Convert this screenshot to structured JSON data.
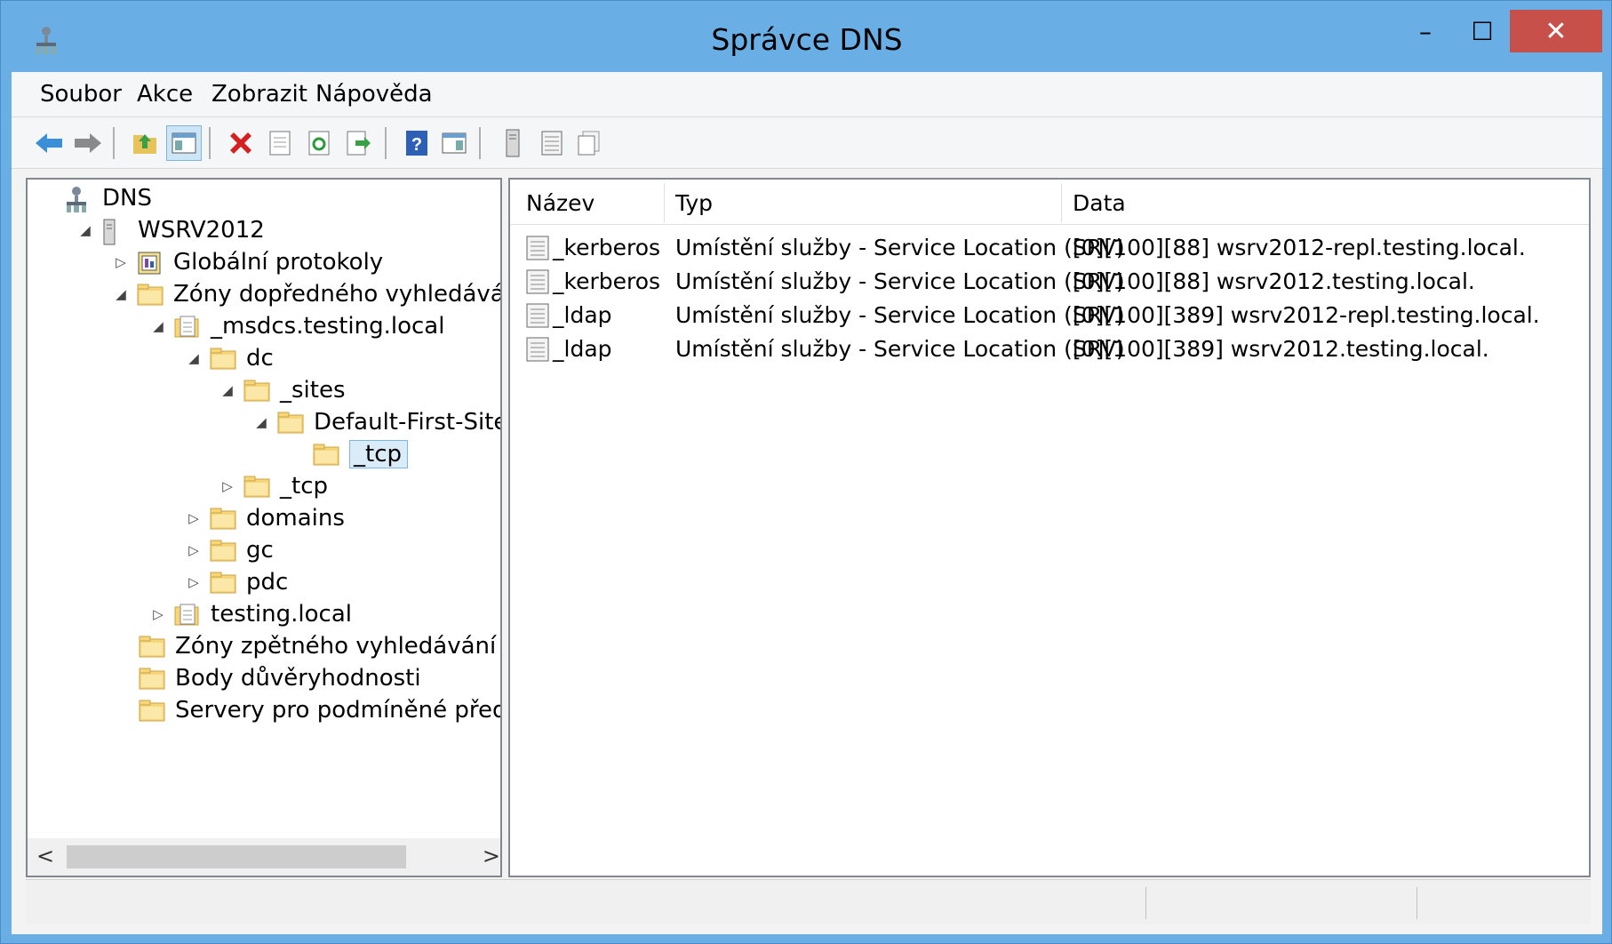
{
  "window": {
    "title": "Správce DNS",
    "controls": {
      "minimize": "–",
      "maximize": "☐",
      "close": "✕"
    }
  },
  "menu": [
    "Soubor",
    "Akce",
    "Zobrazit",
    "Nápověda"
  ],
  "toolbar": [
    "back",
    "forward",
    "up-folder",
    "show-hide-console-tree",
    "delete",
    "properties",
    "refresh",
    "export-list",
    "help",
    "show-hide-action-pane",
    "server",
    "record",
    "copy"
  ],
  "tree": [
    {
      "label": "DNS",
      "icon": "dns-root-icon",
      "expander": ""
    },
    {
      "label": "WSRV2012",
      "icon": "server-icon",
      "expander": "◢"
    },
    {
      "label": "Globální protokoly",
      "icon": "log-icon",
      "expander": "▷"
    },
    {
      "label": "Zóny dopředného vyhledávání",
      "icon": "folder-icon",
      "expander": "◢"
    },
    {
      "label": "_msdcs.testing.local",
      "icon": "zone-icon",
      "expander": "◢"
    },
    {
      "label": "dc",
      "icon": "folder-icon",
      "expander": "◢"
    },
    {
      "label": "_sites",
      "icon": "folder-icon",
      "expander": "◢"
    },
    {
      "label": "Default-First-Site",
      "icon": "folder-icon",
      "expander": "◢"
    },
    {
      "label": "_tcp",
      "icon": "folder-icon",
      "expander": "",
      "selected": true
    },
    {
      "label": "_tcp",
      "icon": "folder-icon",
      "expander": "▷"
    },
    {
      "label": "domains",
      "icon": "folder-icon",
      "expander": "▷"
    },
    {
      "label": "gc",
      "icon": "folder-icon",
      "expander": "▷"
    },
    {
      "label": "pdc",
      "icon": "folder-icon",
      "expander": "▷"
    },
    {
      "label": "testing.local",
      "icon": "zone-icon",
      "expander": "▷"
    },
    {
      "label": "Zóny zpětného vyhledávání",
      "icon": "folder-icon",
      "expander": ""
    },
    {
      "label": "Body důvěryhodnosti",
      "icon": "folder-icon",
      "expander": ""
    },
    {
      "label": "Servery pro podmíněné předává",
      "icon": "folder-icon",
      "expander": ""
    }
  ],
  "scrollbar": {
    "left": "<",
    "right": ">"
  },
  "list": {
    "columns": [
      "Název",
      "Typ",
      "Data"
    ],
    "rows": [
      {
        "name": "_kerberos",
        "type": "Umístění služby - Service Location (SRV)",
        "data": "[0][100][88] wsrv2012-repl.testing.local."
      },
      {
        "name": "_kerberos",
        "type": "Umístění služby - Service Location (SRV)",
        "data": "[0][100][88] wsrv2012.testing.local."
      },
      {
        "name": "_ldap",
        "type": "Umístění služby - Service Location (SRV)",
        "data": "[0][100][389] wsrv2012-repl.testing.local."
      },
      {
        "name": "_ldap",
        "type": "Umístění služby - Service Location (SRV)",
        "data": "[0][100][389] wsrv2012.testing.local."
      }
    ]
  },
  "colors": {
    "titlebar": "#6aaee6",
    "close": "#c7504a",
    "selection": "#dbecf9",
    "folder": "#f7d67a"
  }
}
